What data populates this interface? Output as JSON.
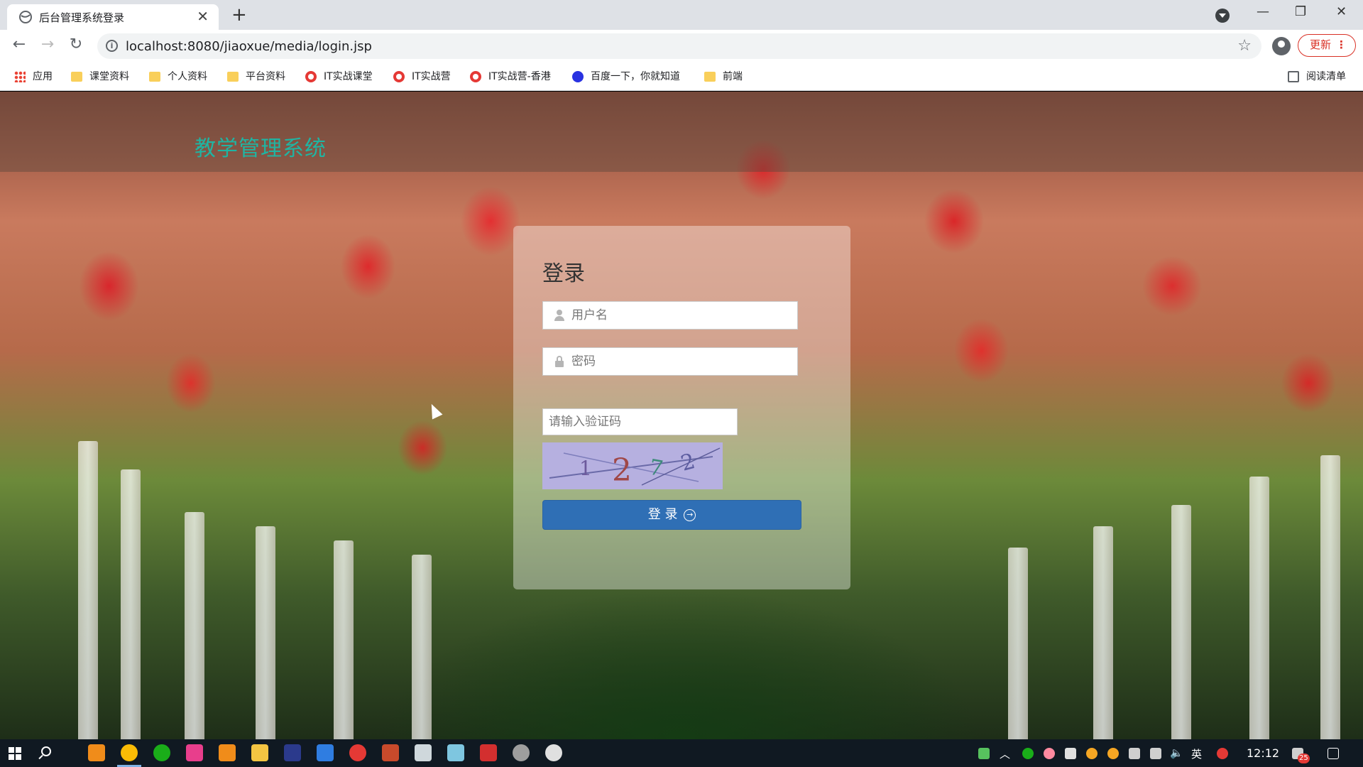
{
  "browser": {
    "tab_title": "后台管理系统登录",
    "tab_close": "✕",
    "new_tab": "+",
    "url": "localhost:8080/jiaoxue/media/login.jsp",
    "update_label": "更新",
    "update_dots": "⋮",
    "window": {
      "minimize": "—",
      "restore": "❐",
      "close": "✕"
    }
  },
  "bookmarks": [
    {
      "label": "应用",
      "icon": "apps-icon"
    },
    {
      "label": "课堂资料",
      "icon": "folder-icon"
    },
    {
      "label": "个人资料",
      "icon": "folder-icon"
    },
    {
      "label": "平台资料",
      "icon": "folder-icon"
    },
    {
      "label": "IT实战课堂",
      "icon": "shield-icon"
    },
    {
      "label": "IT实战营",
      "icon": "shield-icon"
    },
    {
      "label": "IT实战营-香港",
      "icon": "shield-icon"
    },
    {
      "label": "百度一下，你就知道",
      "icon": "paw-icon"
    },
    {
      "label": "前端",
      "icon": "folder-icon"
    }
  ],
  "reading_list": "阅读清单",
  "page": {
    "site_title": "教学管理系统",
    "login": {
      "heading": "登录",
      "username_placeholder": "用户名",
      "password_placeholder": "密码",
      "captcha_placeholder": "请输入验证码",
      "captcha_text": [
        "1",
        "2",
        "7",
        "2"
      ],
      "button_label": "登 录",
      "button_icon": "→"
    }
  },
  "taskbar": {
    "ime": "英",
    "clock": "12:12",
    "notification_count": "25"
  },
  "colors": {
    "site_title": "#1fb5a3",
    "login_button": "#2f6fb5",
    "update_red": "#d93025"
  }
}
